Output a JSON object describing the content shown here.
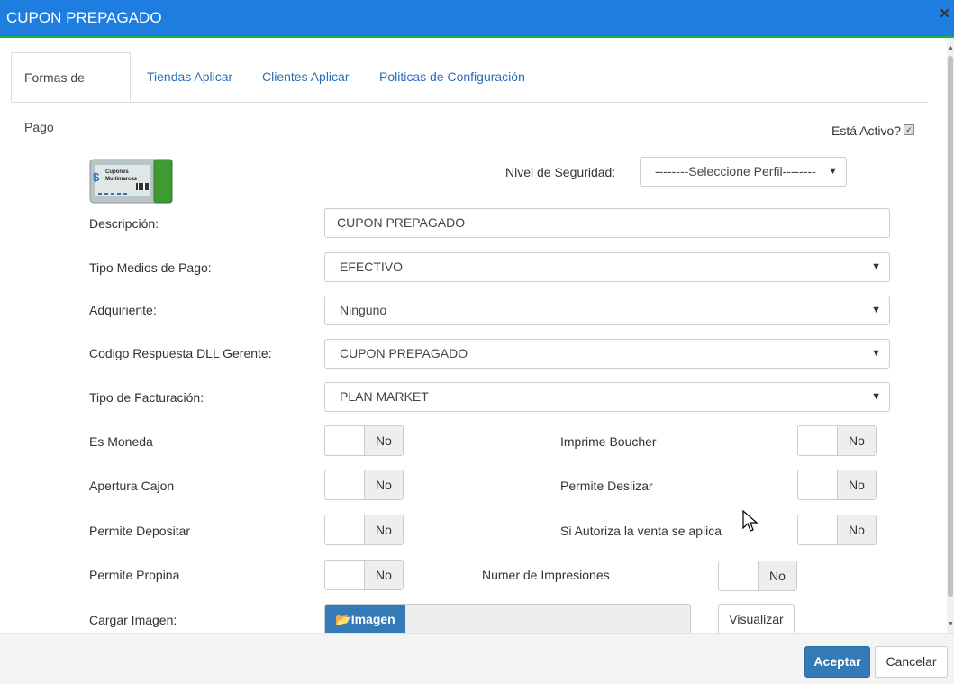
{
  "window": {
    "title": "CUPON PREPAGADO",
    "close_icon": "close-icon"
  },
  "tabs": [
    {
      "label": "Formas de Pago",
      "active": true
    },
    {
      "label": "Tiendas Aplicar",
      "active": false
    },
    {
      "label": "Clientes Aplicar",
      "active": false
    },
    {
      "label": "Politicas de Configuración",
      "active": false
    }
  ],
  "active_checkbox": {
    "label": "Está Activo?",
    "checked": true
  },
  "logo": {
    "line1": "Cupones",
    "line2": "Multimarcas"
  },
  "security": {
    "label": "Nivel de Seguridad:",
    "value": "--------Seleccione Perfil--------"
  },
  "form": {
    "descripcion": {
      "label": "Descripción:",
      "value": "CUPON PREPAGADO"
    },
    "tipo_medios_pago": {
      "label": "Tipo Medios de Pago:",
      "value": "EFECTIVO"
    },
    "adquiriente": {
      "label": "Adquiriente:",
      "value": "Ninguno"
    },
    "codigo_respuesta": {
      "label": "Codigo Respuesta DLL Gerente:",
      "value": "CUPON PREPAGADO"
    },
    "tipo_facturacion": {
      "label": "Tipo de Facturación:",
      "value": "PLAN MARKET"
    }
  },
  "toggles": {
    "es_moneda": {
      "label": "Es Moneda",
      "value": "No"
    },
    "apertura_cajon": {
      "label": "Apertura Cajon",
      "value": "No"
    },
    "permite_depositar": {
      "label": "Permite Depositar",
      "value": "No"
    },
    "permite_propina": {
      "label": "Permite Propina",
      "value": "No"
    },
    "imprime_boucher": {
      "label": "Imprime Boucher",
      "value": "No"
    },
    "permite_deslizar": {
      "label": "Permite Deslizar",
      "value": "No"
    },
    "si_autoriza": {
      "label": "Si Autoriza la venta se aplica",
      "value": "No"
    },
    "numer_impresiones": {
      "label": "Numer de Impresiones",
      "value": "No"
    }
  },
  "image_upload": {
    "label": "Cargar Imagen:",
    "button": "Imagen",
    "view_button": "Visualizar"
  },
  "footer": {
    "accept": "Aceptar",
    "cancel": "Cancelar"
  },
  "colors": {
    "titlebar": "#1e7ee0",
    "accent_line": "#19b34a",
    "primary": "#337ab7"
  }
}
